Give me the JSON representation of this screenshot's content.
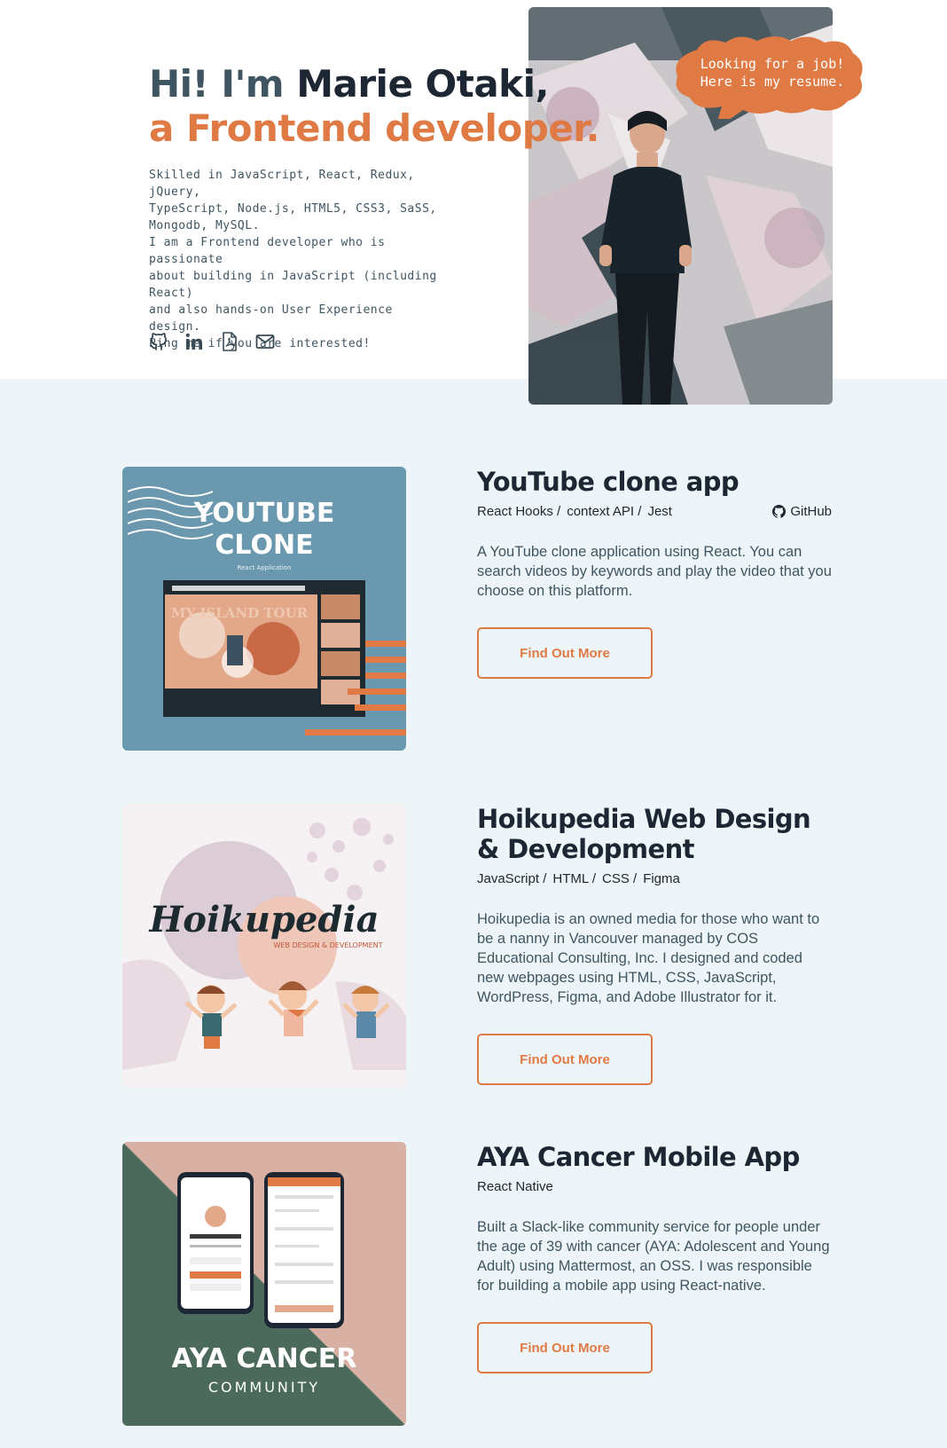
{
  "hero": {
    "greeting": "Hi! I'm ",
    "name": "Marie Otaki,",
    "role": "a Frontend developer.",
    "skills": "Skilled in JavaScript, React, Redux, jQuery,\nTypeScript, Node.js, HTML5, CSS3, SaSS,\nMongodb, MySQL.",
    "about": "I am a Frontend developer who is passionate\nabout building in JavaScript (including React)\nand also hands-on User Experience design.\nPing me if you are interested!",
    "bubble": "Looking for a job!\nHere is my resume.",
    "socials": [
      "github-icon",
      "linkedin-icon",
      "pdf-icon",
      "mail-icon"
    ]
  },
  "projects": [
    {
      "title": "YouTube clone app",
      "tags": [
        "React Hooks /",
        "context API /",
        "Jest"
      ],
      "github_label": "GitHub",
      "description": "A YouTube clone application using React. You can search videos by keywords and play the video that you choose on this platform.",
      "button": "Find Out More",
      "thumb": {
        "title_line1": "YOUTUBE",
        "title_line2": "CLONE",
        "subtitle": "React Application",
        "inner": "MY ISLAND TOUR"
      }
    },
    {
      "title": "Hoikupedia Web Design & Development",
      "tags": [
        "JavaScript /",
        "HTML /",
        "CSS /",
        "Figma"
      ],
      "description": "Hoikupedia is an owned media for those who want to be a nanny in Vancouver managed by COS Educational Consulting, Inc. I designed and coded new webpages using HTML, CSS, JavaScript, WordPress, Figma, and Adobe Illustrator for it.",
      "button": "Find Out More",
      "thumb": {
        "logo": "Hoikupedia",
        "subtitle": "WEB DESIGN & DEVELOPMENT"
      }
    },
    {
      "title": "AYA Cancer Mobile App",
      "tags": [
        "React Native"
      ],
      "description": "Built a Slack-like community service for people under the age of 39 with cancer (AYA: Adolescent and Young Adult) using Mattermost, an OSS. I was responsible for building a mobile app using React-native.",
      "button": "Find Out More",
      "thumb": {
        "title": "AYA CANCER",
        "subtitle": "COMMUNITY"
      }
    }
  ],
  "colors": {
    "accent": "#e07a45",
    "dark": "#1c2733",
    "text": "#3f5561",
    "section_bg": "#edf5f8"
  }
}
